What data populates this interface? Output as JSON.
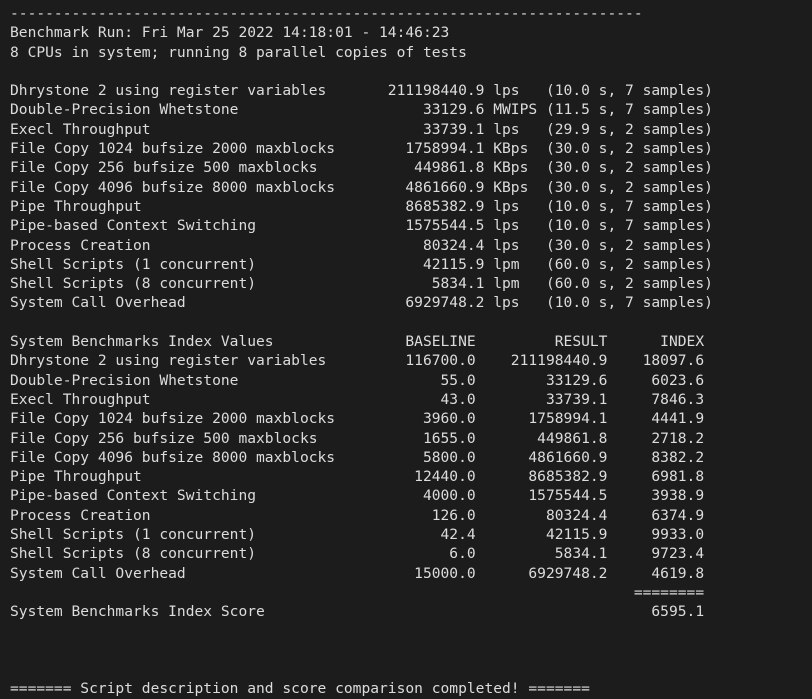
{
  "terminal": {
    "background_color": "#1c1c1c",
    "text_color": "#dcdcdc",
    "rule_top": "------------------------------------------------------------------------",
    "header": {
      "run_line": "Benchmark Run: Fri Mar 25 2022 14:18:01 - 14:46:23",
      "cpu_line": "8 CPUs in system; running 8 parallel copies of tests"
    },
    "raw_results": {
      "rows": [
        {
          "name": "Dhrystone 2 using register variables",
          "value": "211198440.9",
          "unit": "lps",
          "duration": "10.0 s",
          "samples": "7 samples"
        },
        {
          "name": "Double-Precision Whetstone",
          "value": "33129.6",
          "unit": "MWIPS",
          "duration": "11.5 s",
          "samples": "7 samples"
        },
        {
          "name": "Execl Throughput",
          "value": "33739.1",
          "unit": "lps",
          "duration": "29.9 s",
          "samples": "2 samples"
        },
        {
          "name": "File Copy 1024 bufsize 2000 maxblocks",
          "value": "1758994.1",
          "unit": "KBps",
          "duration": "30.0 s",
          "samples": "2 samples"
        },
        {
          "name": "File Copy 256 bufsize 500 maxblocks",
          "value": "449861.8",
          "unit": "KBps",
          "duration": "30.0 s",
          "samples": "2 samples"
        },
        {
          "name": "File Copy 4096 bufsize 8000 maxblocks",
          "value": "4861660.9",
          "unit": "KBps",
          "duration": "30.0 s",
          "samples": "2 samples"
        },
        {
          "name": "Pipe Throughput",
          "value": "8685382.9",
          "unit": "lps",
          "duration": "10.0 s",
          "samples": "7 samples"
        },
        {
          "name": "Pipe-based Context Switching",
          "value": "1575544.5",
          "unit": "lps",
          "duration": "10.0 s",
          "samples": "7 samples"
        },
        {
          "name": "Process Creation",
          "value": "80324.4",
          "unit": "lps",
          "duration": "30.0 s",
          "samples": "2 samples"
        },
        {
          "name": "Shell Scripts (1 concurrent)",
          "value": "42115.9",
          "unit": "lpm",
          "duration": "60.0 s",
          "samples": "2 samples"
        },
        {
          "name": "Shell Scripts (8 concurrent)",
          "value": "5834.1",
          "unit": "lpm",
          "duration": "60.0 s",
          "samples": "2 samples"
        },
        {
          "name": "System Call Overhead",
          "value": "6929748.2",
          "unit": "lps",
          "duration": "10.0 s",
          "samples": "7 samples"
        }
      ]
    },
    "index_table": {
      "title": "System Benchmarks Index Values",
      "columns": [
        "BASELINE",
        "RESULT",
        "INDEX"
      ],
      "rows": [
        {
          "name": "Dhrystone 2 using register variables",
          "baseline": "116700.0",
          "result": "211198440.9",
          "index": "18097.6"
        },
        {
          "name": "Double-Precision Whetstone",
          "baseline": "55.0",
          "result": "33129.6",
          "index": "6023.6"
        },
        {
          "name": "Execl Throughput",
          "baseline": "43.0",
          "result": "33739.1",
          "index": "7846.3"
        },
        {
          "name": "File Copy 1024 bufsize 2000 maxblocks",
          "baseline": "3960.0",
          "result": "1758994.1",
          "index": "4441.9"
        },
        {
          "name": "File Copy 256 bufsize 500 maxblocks",
          "baseline": "1655.0",
          "result": "449861.8",
          "index": "2718.2"
        },
        {
          "name": "File Copy 4096 bufsize 8000 maxblocks",
          "baseline": "5800.0",
          "result": "4861660.9",
          "index": "8382.2"
        },
        {
          "name": "Pipe Throughput",
          "baseline": "12440.0",
          "result": "8685382.9",
          "index": "6981.8"
        },
        {
          "name": "Pipe-based Context Switching",
          "baseline": "4000.0",
          "result": "1575544.5",
          "index": "3938.9"
        },
        {
          "name": "Process Creation",
          "baseline": "126.0",
          "result": "80324.4",
          "index": "6374.9"
        },
        {
          "name": "Shell Scripts (1 concurrent)",
          "baseline": "42.4",
          "result": "42115.9",
          "index": "9933.0"
        },
        {
          "name": "Shell Scripts (8 concurrent)",
          "baseline": "6.0",
          "result": "5834.1",
          "index": "9723.4"
        },
        {
          "name": "System Call Overhead",
          "baseline": "15000.0",
          "result": "6929748.2",
          "index": "4619.8"
        }
      ],
      "separator": "========",
      "score_label": "System Benchmarks Index Score",
      "score_value": "6595.1"
    },
    "footer": {
      "completion_line": "======= Script description and score comparison completed! ======="
    }
  }
}
